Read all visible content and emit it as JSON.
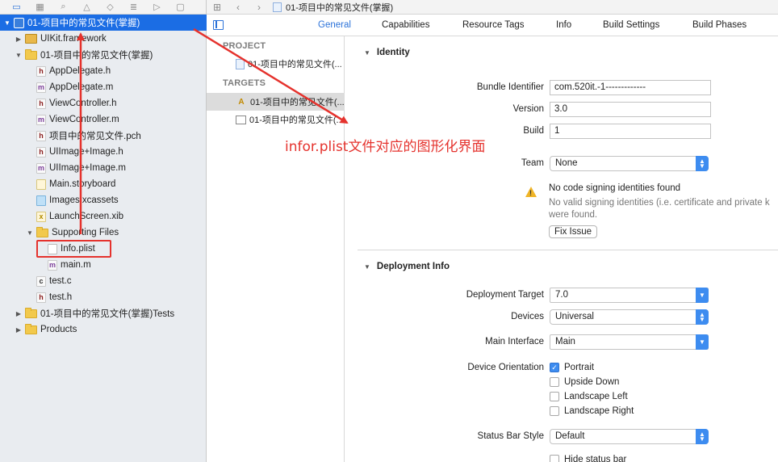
{
  "navigator": {
    "toolbar_icons": [
      "folder-icon",
      "symbol-icon",
      "search-icon",
      "warning-icon",
      "test-icon",
      "debug-icon",
      "breakpoint-icon",
      "report-icon"
    ],
    "items": [
      {
        "label": "01-项目中的常见文件(掌握)",
        "kind": "project"
      },
      {
        "label": "UIKit.framework",
        "kind": "framework"
      },
      {
        "label": "01-项目中的常见文件(掌握)",
        "kind": "folder"
      },
      {
        "label": "AppDelegate.h",
        "kind": "h",
        "badge": "h"
      },
      {
        "label": "AppDelegate.m",
        "kind": "m",
        "badge": "m"
      },
      {
        "label": "ViewController.h",
        "kind": "h",
        "badge": "h"
      },
      {
        "label": "ViewController.m",
        "kind": "m",
        "badge": "m"
      },
      {
        "label": "项目中的常见文件.pch",
        "kind": "pch",
        "badge": "h"
      },
      {
        "label": "UIImage+Image.h",
        "kind": "h",
        "badge": "h"
      },
      {
        "label": "UIImage+Image.m",
        "kind": "m",
        "badge": "m"
      },
      {
        "label": "Main.storyboard",
        "kind": "sb",
        "badge": ""
      },
      {
        "label": "Images.xcassets",
        "kind": "assets",
        "badge": ""
      },
      {
        "label": "LaunchScreen.xib",
        "kind": "xib",
        "badge": "x"
      },
      {
        "label": "Supporting Files",
        "kind": "folder"
      },
      {
        "label": "Info.plist",
        "kind": "plist",
        "badge": ""
      },
      {
        "label": "main.m",
        "kind": "m",
        "badge": "m"
      },
      {
        "label": "test.c",
        "kind": "c",
        "badge": "c"
      },
      {
        "label": "test.h",
        "kind": "h",
        "badge": "h"
      },
      {
        "label": "01-项目中的常见文件(掌握)Tests",
        "kind": "folder"
      },
      {
        "label": "Products",
        "kind": "folder"
      }
    ]
  },
  "editor": {
    "breadcrumb": "01-项目中的常见文件(掌握)",
    "tabs": [
      "General",
      "Capabilities",
      "Resource Tags",
      "Info",
      "Build Settings",
      "Build Phases"
    ],
    "project_header": "PROJECT",
    "project_item": "01-项目中的常见文件(...",
    "targets_header": "TARGETS",
    "target_items": [
      "01-项目中的常见文件(...",
      "01-项目中的常见文件(..."
    ]
  },
  "identity": {
    "title": "Identity",
    "bundle_identifier_label": "Bundle Identifier",
    "bundle_identifier": "com.520it.-1-------------",
    "version_label": "Version",
    "version": "3.0",
    "build_label": "Build",
    "build": "1",
    "team_label": "Team",
    "team": "None",
    "signing_warning": "No code signing identities found",
    "signing_detail_1": "No valid signing identities (i.e. certificate and private k",
    "signing_detail_2": "were found.",
    "fix_button": "Fix Issue"
  },
  "deployment": {
    "title": "Deployment Info",
    "target_label": "Deployment Target",
    "target": "7.0",
    "devices_label": "Devices",
    "devices": "Universal",
    "main_interface_label": "Main Interface",
    "main_interface": "Main",
    "orientation_label": "Device Orientation",
    "orientations": [
      {
        "label": "Portrait",
        "checked": true
      },
      {
        "label": "Upside Down",
        "checked": false
      },
      {
        "label": "Landscape Left",
        "checked": false
      },
      {
        "label": "Landscape Right",
        "checked": false
      }
    ],
    "status_bar_label": "Status Bar Style",
    "status_bar": "Default",
    "hide_status_bar": "Hide status bar"
  },
  "annotation": {
    "text": "infor.plist文件对应的图形化界面",
    "color": "#e5322d"
  }
}
